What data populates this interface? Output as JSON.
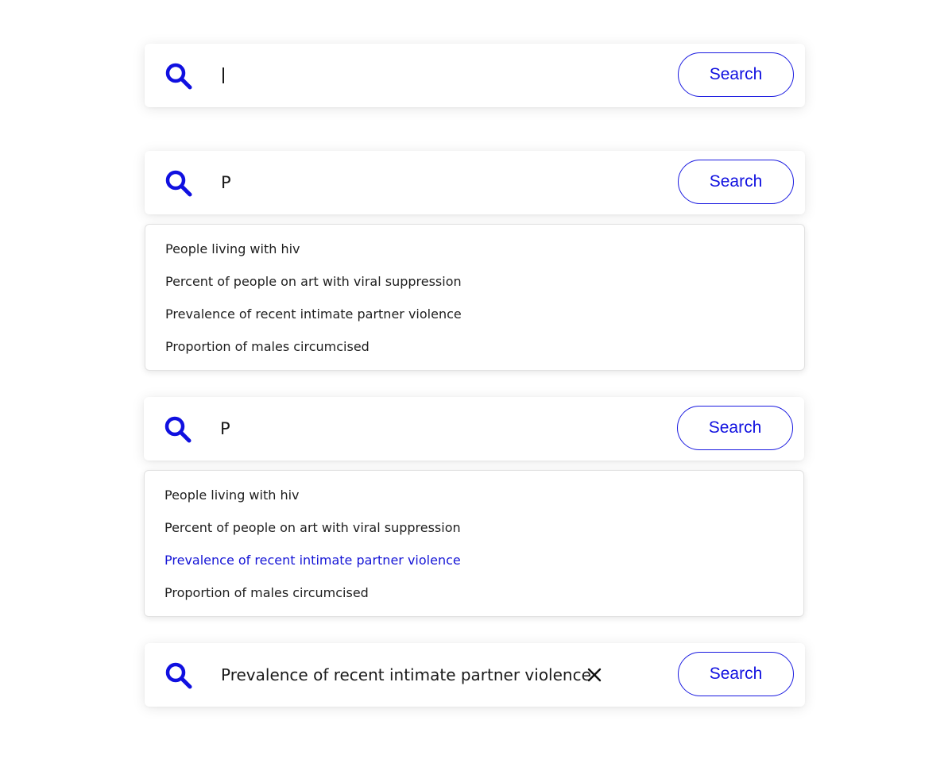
{
  "colors": {
    "accent": "#1010e0",
    "text": "#1e1e1e",
    "highlight": "#1515d6"
  },
  "states": [
    {
      "query": "",
      "button_label": "Search",
      "icon": "search-icon"
    },
    {
      "query": "P",
      "button_label": "Search",
      "icon": "search-icon",
      "suggestions": [
        "People living with hiv",
        "Percent of people on art with viral suppression",
        "Prevalence of recent intimate partner violence",
        "Proportion of males circumcised"
      ]
    },
    {
      "query": "P",
      "button_label": "Search",
      "icon": "search-icon",
      "highlighted_index": 2,
      "suggestions": [
        "People living with hiv",
        "Percent of people on art with viral suppression",
        "Prevalence of recent intimate partner violence",
        "Proportion of males circumcised"
      ]
    },
    {
      "query": "Prevalence of recent intimate partner violence",
      "button_label": "Search",
      "icon": "search-icon",
      "clear_icon": "close-icon"
    }
  ]
}
